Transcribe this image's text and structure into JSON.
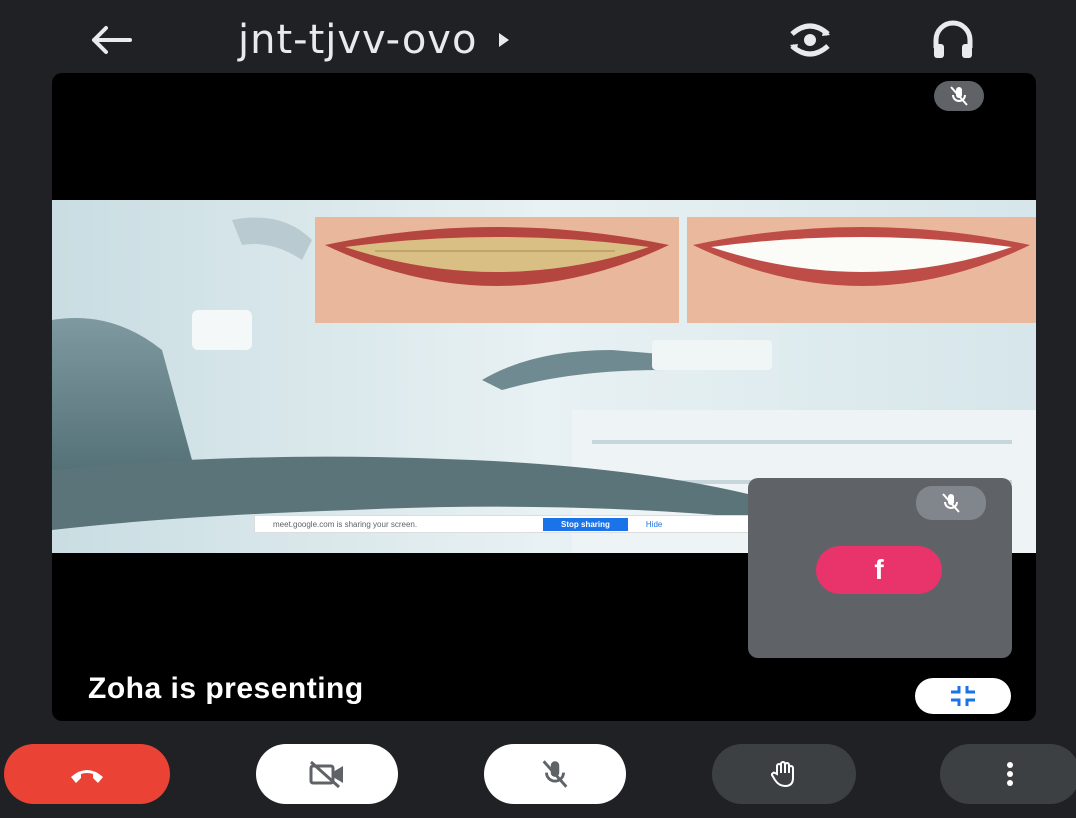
{
  "header": {
    "meeting_code": "jnt-tjvv-ovo",
    "back_icon": "arrow-left-icon",
    "switch_camera_icon": "switch-camera-icon",
    "audio_icon": "headphones-icon"
  },
  "presentation": {
    "banner_text": "meet.google.com is sharing your screen.",
    "banner_stop_label": "Stop sharing",
    "banner_hide_label": "Hide",
    "presenter_label": "Zoha is presenting",
    "muted_icon": "mic-off-icon",
    "fullscreen_icon": "exit-fullscreen-icon"
  },
  "self_view": {
    "avatar_letter": "f",
    "avatar_color": "#e8336b",
    "muted_icon": "mic-off-icon"
  },
  "controls": {
    "end_call_icon": "end-call-icon",
    "end_call_color": "#ea4335",
    "camera_icon": "camera-off-icon",
    "mic_icon": "mic-off-icon",
    "raise_hand_icon": "raise-hand-icon",
    "more_icon": "more-vert-icon"
  }
}
